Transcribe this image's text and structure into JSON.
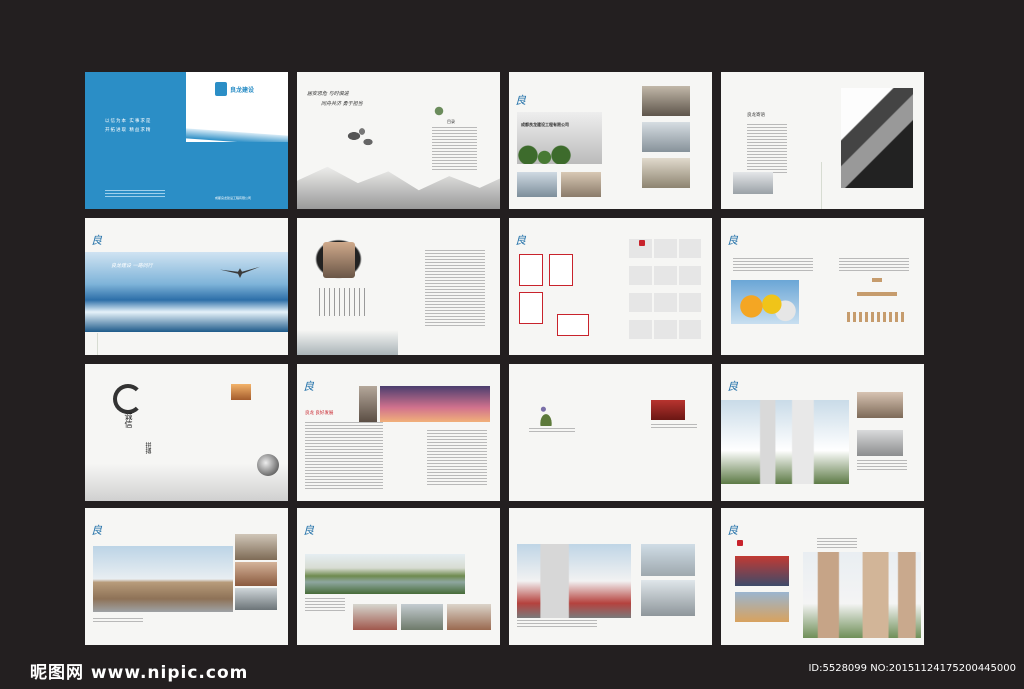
{
  "cover": {
    "company_logo": "良龙建设",
    "slogan_line1": "以信为本 实事求是",
    "slogan_line2": "开拓进取 精益求精",
    "company_name": "成都良龙建设工程有限公司"
  },
  "toc": {
    "calligraphy_line1": "居安思危 与时俱进",
    "calligraphy_line2": "同舟共济 勇于担当",
    "heading": "目录"
  },
  "spread3": {
    "sign_text": "成都良龙建设工程有限公司"
  },
  "spread4": {
    "heading": "良龙寄语"
  },
  "spread5": {
    "banner_text": "良龙建设 一路同行"
  },
  "spread9": {
    "word1": "诚信",
    "word2": "拼搏"
  },
  "spread10": {
    "heading": "良龙 良好发展"
  },
  "watermark": {
    "brand": "昵图网 www.nipic.com",
    "id": "ID:5528099 NO:20151124175200445000"
  },
  "colors": {
    "background": "#231f20",
    "cover_blue": "#2b8ec6",
    "accent_red": "#c8232c"
  }
}
